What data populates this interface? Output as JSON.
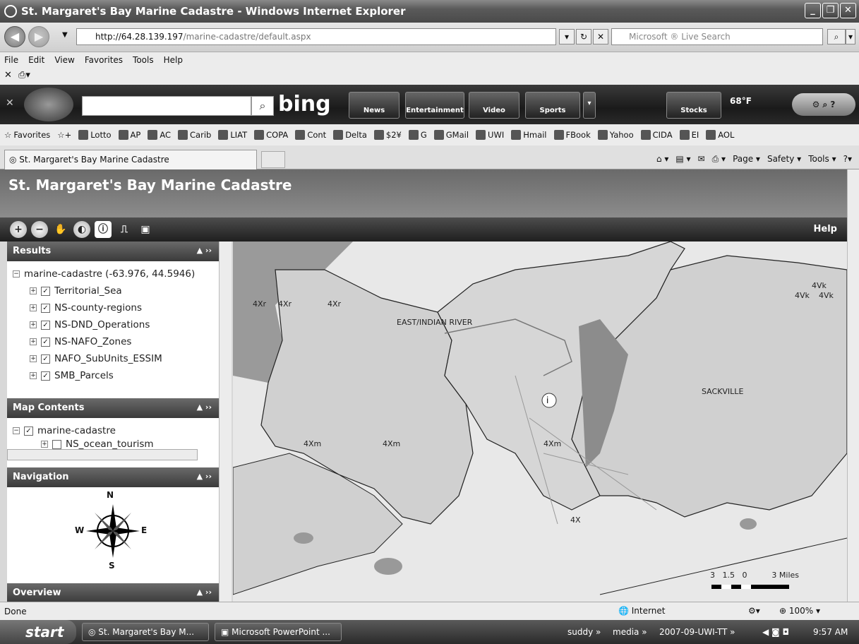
{
  "window": {
    "title": "St. Margaret's Bay Marine Cadastre - Windows Internet Explorer"
  },
  "address": {
    "url_host": "http://64.28.139.197",
    "url_path": "/marine-cadastre/default.aspx",
    "search_placeholder": "Microsoft ® Live Search"
  },
  "menu": [
    "File",
    "Edit",
    "View",
    "Favorites",
    "Tools",
    "Help"
  ],
  "bing": {
    "logo": "bing",
    "buttons": [
      "News",
      "Entertainment",
      "Video",
      "Sports"
    ],
    "stocks": "Stocks",
    "temp": "68°F"
  },
  "favorites": {
    "label": "Favorites",
    "items": [
      "Lotto",
      "AP",
      "AC",
      "Carib",
      "LIAT",
      "COPA",
      "Cont",
      "Delta",
      "$2¥",
      "G",
      "GMail",
      "UWI",
      "Hmail",
      "FBook",
      "Yahoo",
      "CIDA",
      "EI",
      "AOL"
    ]
  },
  "tab": {
    "label": "St. Margaret's Bay Marine Cadastre"
  },
  "commands": [
    "Page ▾",
    "Safety ▾",
    "Tools ▾"
  ],
  "app": {
    "title": "St. Margaret's Bay Marine Cadastre",
    "help": "Help"
  },
  "results": {
    "title": "Results",
    "root": "marine-cadastre (-63.976, 44.5946)",
    "layers": [
      "Territorial_Sea",
      "NS-county-regions",
      "NS-DND_Operations",
      "NS-NAFO_Zones",
      "NAFO_SubUnits_ESSIM",
      "SMB_Parcels"
    ]
  },
  "contents": {
    "title": "Map Contents",
    "root": "marine-cadastre",
    "child": "NS_ocean_tourism"
  },
  "navigation": {
    "title": "Navigation",
    "n": "N",
    "s": "S",
    "e": "E",
    "w": "W"
  },
  "overview": {
    "title": "Overview"
  },
  "map": {
    "labels": [
      "4Xr",
      "4Xr",
      "4Xr",
      "EAST/INDIAN RIVER",
      "SACKVILLE",
      "4Xm",
      "4Xm",
      "4Xm",
      "4X",
      "4Vk",
      "4Vk",
      "4Vk"
    ],
    "scale": "3   1.5   0          3 Miles"
  },
  "status": {
    "text": "Done",
    "zone": "Internet",
    "zoom": "100%"
  },
  "taskbar": {
    "start": "start",
    "tasks": [
      "St. Margaret's Bay M...",
      "Microsoft PowerPoint ..."
    ],
    "tray": [
      "suddy",
      "media",
      "2007-09-UWI-TT"
    ],
    "time": "9:57 AM"
  }
}
